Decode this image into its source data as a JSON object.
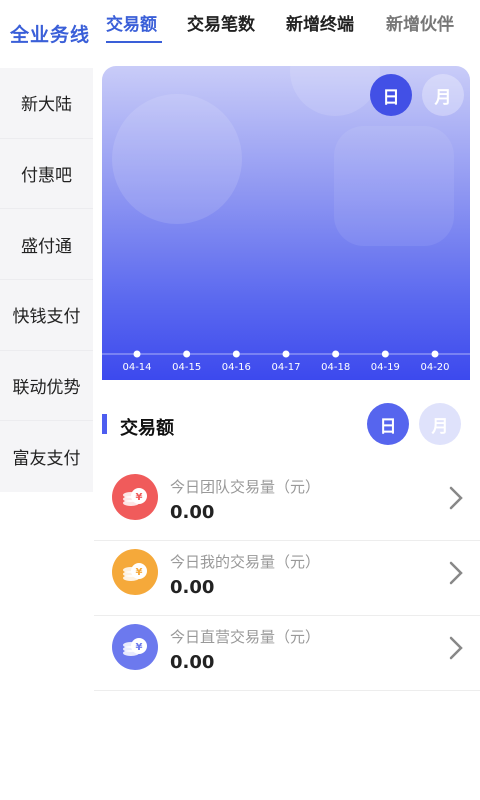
{
  "header": {
    "brand": "全业务线",
    "tabs": [
      {
        "label": "交易额"
      },
      {
        "label": "交易笔数"
      },
      {
        "label": "新增终端"
      },
      {
        "label": "新增伙伴"
      }
    ]
  },
  "sidebar": {
    "items": [
      {
        "label": "新大陆"
      },
      {
        "label": "付惠吧"
      },
      {
        "label": "盛付通"
      },
      {
        "label": "快钱支付"
      },
      {
        "label": "联动优势"
      },
      {
        "label": "富友支付"
      }
    ]
  },
  "chart": {
    "toggle_day": "日",
    "toggle_month": "月"
  },
  "chart_data": {
    "type": "line",
    "x": [
      "04-14",
      "04-15",
      "04-16",
      "04-17",
      "04-18",
      "04-19",
      "04-20"
    ],
    "series": [
      {
        "values": [
          0,
          0,
          0,
          0,
          0,
          0,
          0
        ]
      }
    ]
  },
  "section": {
    "title": "交易额",
    "toggle_day": "日",
    "toggle_month": "月"
  },
  "list": [
    {
      "label": "今日团队交易量（元）",
      "value": "0.00",
      "color": "#f05b5b",
      "icon": "coin-stack-icon"
    },
    {
      "label": "今日我的交易量（元）",
      "value": "0.00",
      "color": "#f5a93a",
      "icon": "coin-stack-icon"
    },
    {
      "label": "今日直营交易量（元）",
      "value": "0.00",
      "color": "#6c79ee",
      "icon": "coin-stack-icon"
    }
  ]
}
